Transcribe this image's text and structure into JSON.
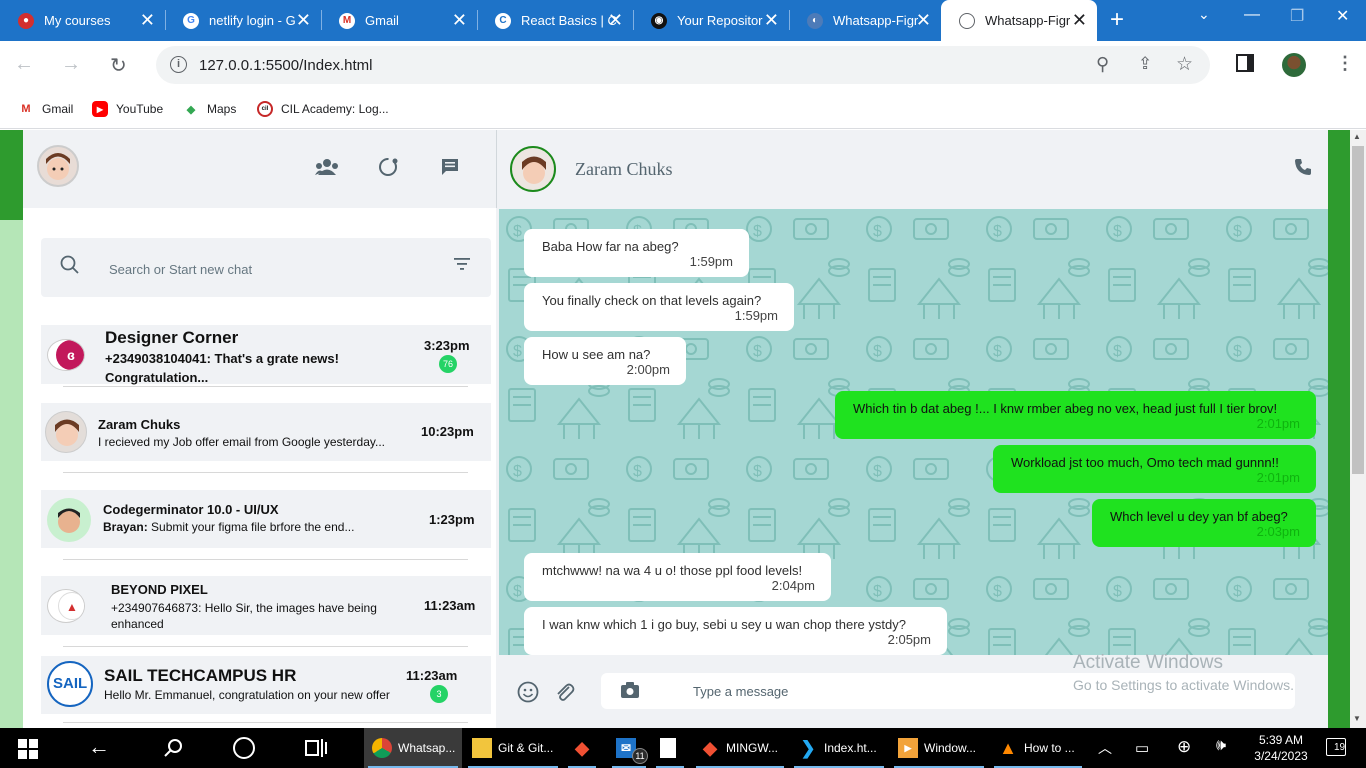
{
  "browser": {
    "tabs": [
      {
        "title": "My courses",
        "favicon": "red-circle-icon"
      },
      {
        "title": "netlify login - G",
        "favicon": "google-icon"
      },
      {
        "title": "Gmail",
        "favicon": "gmail-icon"
      },
      {
        "title": "React Basics | C",
        "favicon": "codecademy-icon"
      },
      {
        "title": "Your Repositor",
        "favicon": "github-icon"
      },
      {
        "title": "Whatsapp-Figr",
        "favicon": "figma-icon"
      },
      {
        "title": "Whatsapp-Figr",
        "favicon": "globe-icon"
      }
    ],
    "new_tab": "+",
    "url": "127.0.0.1:5500/Index.html",
    "bookmarks": [
      {
        "label": "Gmail",
        "icon": "gmail-icon"
      },
      {
        "label": "YouTube",
        "icon": "youtube-icon"
      },
      {
        "label": "Maps",
        "icon": "maps-icon"
      },
      {
        "label": "CIL Academy: Log...",
        "icon": "cil-icon"
      }
    ]
  },
  "app": {
    "search_placeholder": "Search or Start new chat",
    "chats": [
      {
        "name": "Designer Corner",
        "message": "+2349038104041: That's a grate news! Congratulation...",
        "time": "3:23pm",
        "badge": "76"
      },
      {
        "name": "Zaram Chuks",
        "message": "I recieved my Job offer email from Google yesterday...",
        "time": "10:23pm",
        "badge": ""
      },
      {
        "name": "Codegerminator 10.0 - UI/UX",
        "sender": "Brayan:",
        "message": " Submit your figma file brfore the end...",
        "time": "1:23pm",
        "badge": ""
      },
      {
        "name": "BEYOND PIXEL",
        "message": "+234907646873: Hello Sir, the images have being enhanced",
        "time": "11:23am",
        "badge": ""
      },
      {
        "name": "SAIL TECHCAMPUS HR",
        "message": "Hello Mr. Emmanuel, congratulation on your new offer",
        "time": "11:23am",
        "badge": "3"
      }
    ],
    "active_chat": {
      "name": "Zaram Chuks",
      "messages": [
        {
          "dir": "in",
          "text": "Baba How far na abeg?",
          "time": "1:59pm"
        },
        {
          "dir": "in",
          "text": "You finally check on that levels again?",
          "time": "1:59pm"
        },
        {
          "dir": "in",
          "text": "How u see am na?",
          "time": "2:00pm"
        },
        {
          "dir": "out",
          "text": "Which tin b dat abeg !... I knw rmber abeg no vex, head just full I tier brov!",
          "time": "2:01pm"
        },
        {
          "dir": "out",
          "text": "Workload jst too much, Omo tech mad gunnn!!",
          "time": "2:01pm"
        },
        {
          "dir": "out",
          "text": "Whch level u dey yan bf abeg?",
          "time": "2:03pm"
        },
        {
          "dir": "in",
          "text": "mtchwww! na wa 4 u o! those ppl food levels!",
          "time": "2:04pm"
        },
        {
          "dir": "in",
          "text": "I wan knw which 1 i go buy, sebi u sey u wan chop there ystdy?",
          "time": "2:05pm"
        }
      ]
    },
    "composer_placeholder": "Type a message",
    "colors": {
      "accent_green": "#1fe21f",
      "header_green": "#2e9b2e",
      "chat_bg": "#a5d7d3"
    }
  },
  "watermark": {
    "line1": "Activate Windows",
    "line2": "Go to Settings to activate Windows."
  },
  "taskbar": {
    "items": [
      {
        "label": "Whatsap...",
        "icon": "chrome-icon"
      },
      {
        "label": "Git & Git...",
        "icon": "folder-icon"
      },
      {
        "label": "",
        "icon": "git-icon"
      },
      {
        "label": "",
        "icon": "mail-icon",
        "badge": "11"
      },
      {
        "label": "",
        "icon": "document-icon"
      },
      {
        "label": "MINGW...",
        "icon": "mingw-icon"
      },
      {
        "label": "Index.ht...",
        "icon": "vscode-icon"
      },
      {
        "label": "Window...",
        "icon": "media-icon"
      },
      {
        "label": "How to ...",
        "icon": "vlc-icon"
      }
    ],
    "time": "5:39 AM",
    "date": "3/24/2023",
    "notifications": "19"
  }
}
